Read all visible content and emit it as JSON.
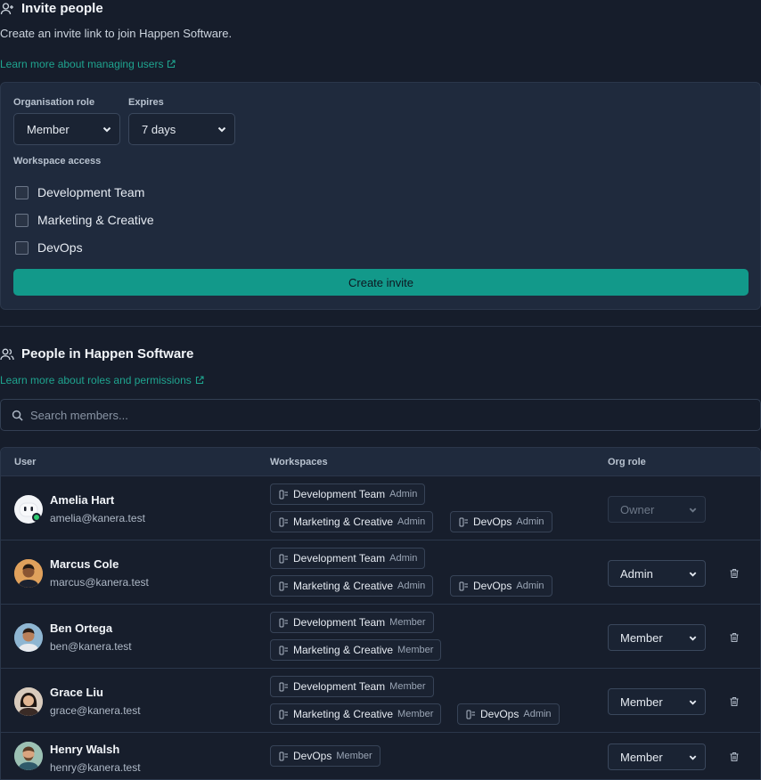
{
  "invite": {
    "title": "Invite people",
    "description": "Create an invite link to join Happen Software.",
    "learn_link": "Learn more about managing users",
    "org_role_label": "Organisation role",
    "org_role_value": "Member",
    "expires_label": "Expires",
    "expires_value": "7 days",
    "workspace_access_label": "Workspace access",
    "workspaces": [
      "Development Team",
      "Marketing & Creative",
      "DevOps"
    ],
    "create_button": "Create invite"
  },
  "people": {
    "title": "People in Happen Software",
    "learn_link": "Learn more about roles and permissions",
    "search_placeholder": "Search members...",
    "columns": {
      "user": "User",
      "workspaces": "Workspaces",
      "org_role": "Org role"
    },
    "members": [
      {
        "name": "Amelia Hart",
        "email": "amelia@kanera.test",
        "org_role": "Owner",
        "workspaces": [
          {
            "name": "Development Team",
            "role": "Admin"
          },
          {
            "name": "Marketing & Creative",
            "role": "Admin"
          },
          {
            "name": "DevOps",
            "role": "Admin"
          }
        ]
      },
      {
        "name": "Marcus Cole",
        "email": "marcus@kanera.test",
        "org_role": "Admin",
        "workspaces": [
          {
            "name": "Development Team",
            "role": "Admin"
          },
          {
            "name": "Marketing & Creative",
            "role": "Admin"
          },
          {
            "name": "DevOps",
            "role": "Admin"
          }
        ]
      },
      {
        "name": "Ben Ortega",
        "email": "ben@kanera.test",
        "org_role": "Member",
        "workspaces": [
          {
            "name": "Development Team",
            "role": "Member"
          },
          {
            "name": "Marketing & Creative",
            "role": "Member"
          }
        ]
      },
      {
        "name": "Grace Liu",
        "email": "grace@kanera.test",
        "org_role": "Member",
        "workspaces": [
          {
            "name": "Development Team",
            "role": "Member"
          },
          {
            "name": "Marketing & Creative",
            "role": "Member"
          },
          {
            "name": "DevOps",
            "role": "Admin"
          }
        ]
      },
      {
        "name": "Henry Walsh",
        "email": "henry@kanera.test",
        "org_role": "Member",
        "workspaces": [
          {
            "name": "DevOps",
            "role": "Member"
          }
        ]
      }
    ]
  },
  "colors": {
    "accent": "#1fa48f",
    "button": "#12998a",
    "background": "#161d2b",
    "card": "#1f2a3d"
  },
  "icons": [
    "user-plus-icon",
    "external-link-icon",
    "chevron-down-icon",
    "users-icon",
    "search-icon",
    "workspace-icon",
    "trash-icon",
    "online-status-icon"
  ]
}
